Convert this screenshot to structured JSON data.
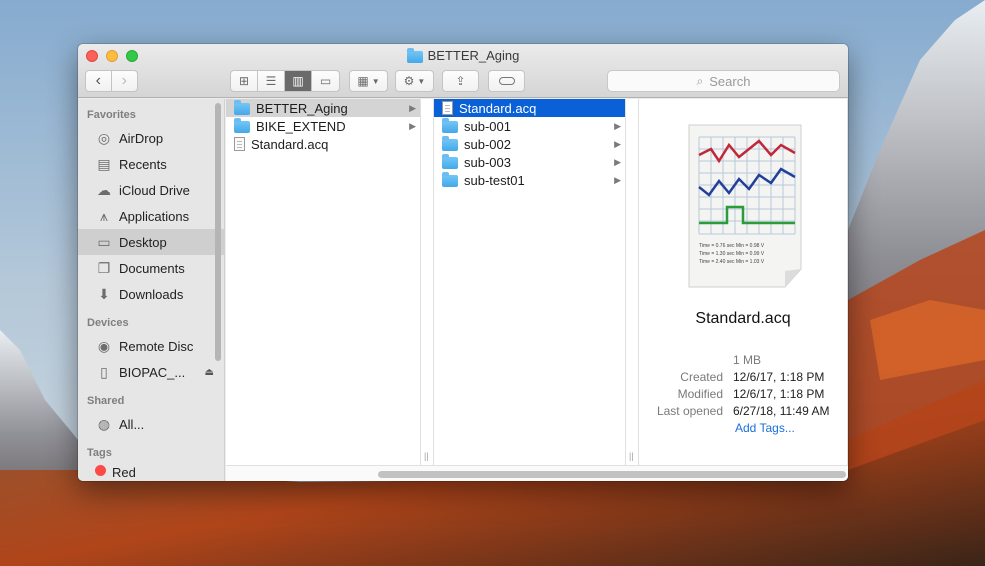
{
  "window": {
    "title": "BETTER_Aging"
  },
  "toolbar": {
    "back_icon": "chevron-left-icon",
    "forward_icon": "chevron-right-icon",
    "view_modes": [
      "icon-view-icon",
      "list-view-icon",
      "column-view-icon",
      "gallery-view-icon"
    ],
    "arrange_icon": "group-icon",
    "action_icon": "gear-icon",
    "share_icon": "share-icon",
    "tag_icon": "tag-icon",
    "search_placeholder": "Search"
  },
  "sidebar": {
    "favorites_header": "Favorites",
    "favorites": [
      {
        "label": "AirDrop",
        "icon": "airdrop-icon"
      },
      {
        "label": "Recents",
        "icon": "recents-icon"
      },
      {
        "label": "iCloud Drive",
        "icon": "cloud-icon"
      },
      {
        "label": "Applications",
        "icon": "applications-icon"
      },
      {
        "label": "Desktop",
        "icon": "desktop-icon",
        "selected": true
      },
      {
        "label": "Documents",
        "icon": "documents-icon"
      },
      {
        "label": "Downloads",
        "icon": "downloads-icon"
      }
    ],
    "devices_header": "Devices",
    "devices": [
      {
        "label": "Remote Disc",
        "icon": "disc-icon"
      },
      {
        "label": "BIOPAC_...",
        "icon": "drive-icon",
        "eject": true
      }
    ],
    "shared_header": "Shared",
    "shared": [
      {
        "label": "All...",
        "icon": "network-icon"
      }
    ],
    "tags_header": "Tags",
    "tags": [
      {
        "label": "Red",
        "color": "#fc4b46"
      }
    ]
  },
  "columns": {
    "col1": [
      {
        "name": "BETTER_Aging",
        "type": "folder",
        "has_children": true,
        "state": "path"
      },
      {
        "name": "BIKE_EXTEND",
        "type": "folder",
        "has_children": true
      },
      {
        "name": "Standard.acq",
        "type": "file"
      }
    ],
    "col2": [
      {
        "name": "Standard.acq",
        "type": "file",
        "state": "selected"
      },
      {
        "name": "sub-001",
        "type": "folder",
        "has_children": true
      },
      {
        "name": "sub-002",
        "type": "folder",
        "has_children": true
      },
      {
        "name": "sub-003",
        "type": "folder",
        "has_children": true
      },
      {
        "name": "sub-test01",
        "type": "folder",
        "has_children": true
      }
    ]
  },
  "preview": {
    "file_name": "Standard.acq",
    "size": "1 MB",
    "created_label": "Created",
    "created": "12/6/17, 1:18 PM",
    "modified_label": "Modified",
    "modified": "12/6/17, 1:18 PM",
    "last_opened_label": "Last opened",
    "last_opened": "6/27/18, 11:49 AM",
    "add_tags": "Add Tags...",
    "thumb_lines": [
      "Time = 0.76 sec   Min = 0.98 V",
      "Time = 1.30 sec   Min = 0.99 V",
      "Time = 2.40 sec   Min = 1.03 V"
    ]
  },
  "colors": {
    "selection_blue": "#0a60d6",
    "folder_blue": "#4eb0ee",
    "link_blue": "#1a6fdc"
  }
}
